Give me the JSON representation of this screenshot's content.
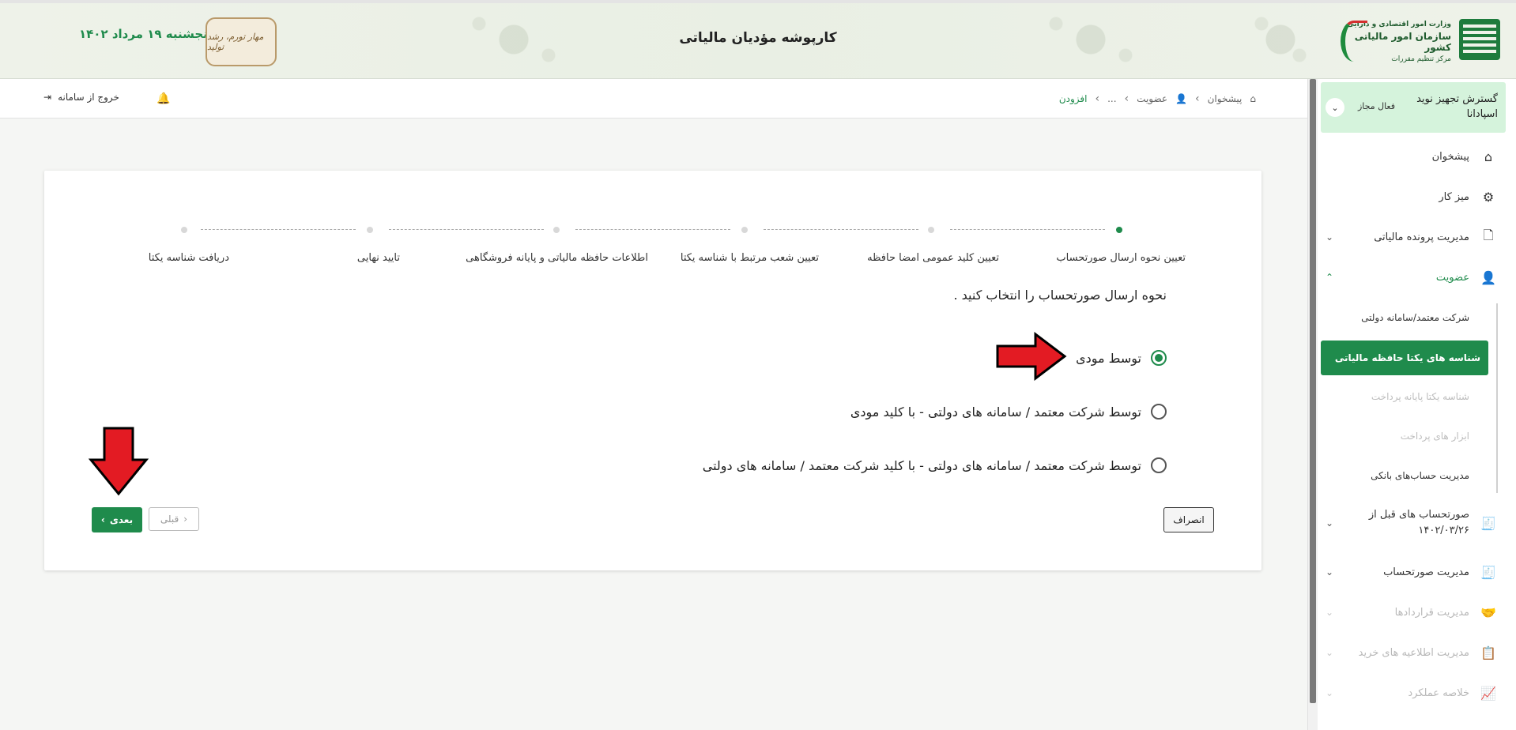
{
  "header": {
    "title": "کارپوشه مؤدیان مالیاتی",
    "date": "پنجشنبه ۱۹ مرداد ۱۴۰۲",
    "seal_text": "مهار تورم، رشد تولید",
    "org": {
      "line1": "وزارت امور اقتصادی و دارایی",
      "line2": "سازمان امور مالیاتی کشور",
      "line3": "مرکز تنظیم مقررات"
    }
  },
  "subheader": {
    "breadcrumb": [
      "پیشخوان",
      "عضویت",
      "...",
      "افزودن"
    ],
    "exit_label": "خروج از سامانه"
  },
  "sidebar": {
    "org_name": "گسترش تجهیز نوید اسپادانا",
    "org_status": "فعال مجاز",
    "items": [
      {
        "label": "پیشخوان",
        "icon": "home-icon"
      },
      {
        "label": "میز کار",
        "icon": "shapes-icon"
      },
      {
        "label": "مدیریت پرونده مالیاتی",
        "icon": "file-icon"
      },
      {
        "label": "عضویت",
        "icon": "user-icon"
      },
      {
        "label": "صورتحساب های قبل از ۱۴۰۲/۰۳/۲۶",
        "icon": "receipt-icon"
      },
      {
        "label": "مدیریت صورتحساب",
        "icon": "receipt-icon"
      },
      {
        "label": "مدیریت قراردادها",
        "icon": "handshake-icon"
      },
      {
        "label": "مدیریت اطلاعیه های خرید",
        "icon": "clipboard-icon"
      },
      {
        "label": "خلاصه عملکرد",
        "icon": "chart-icon"
      }
    ],
    "sub_items": [
      "شرکت معتمد/سامانه دولتی",
      "شناسه های یکتا حافظه مالیاتی",
      "شناسه یکتا پایانه پرداخت",
      "ابزار های پرداخت",
      "مدیریت حساب‌های بانکی"
    ]
  },
  "stepper": {
    "steps": [
      "تعیین نحوه ارسال صورتحساب",
      "تعیین کلید عمومی امضا حافظه",
      "تعیین شعب مرتبط با شناسه یکتا",
      "اطلاعات حافظه مالیاتی و پایانه فروشگاهی",
      "تایید نهایی",
      "دریافت شناسه یکتا"
    ],
    "active_index": 0
  },
  "form": {
    "question": "نحوه ارسال صورتحساب را انتخاب کنید .",
    "options": [
      "توسط مودی",
      "توسط شرکت معتمد / سامانه های دولتی - با کلید مودی",
      "توسط شرکت معتمد / سامانه های دولتی - با کلید شرکت معتمد / سامانه های دولتی"
    ],
    "selected_index": 0,
    "cancel_label": "انصراف",
    "prev_label": "قبلی",
    "next_label": "بعدی"
  },
  "colors": {
    "brand_green": "#1f8b4c",
    "annotation_red": "#e31b23"
  }
}
